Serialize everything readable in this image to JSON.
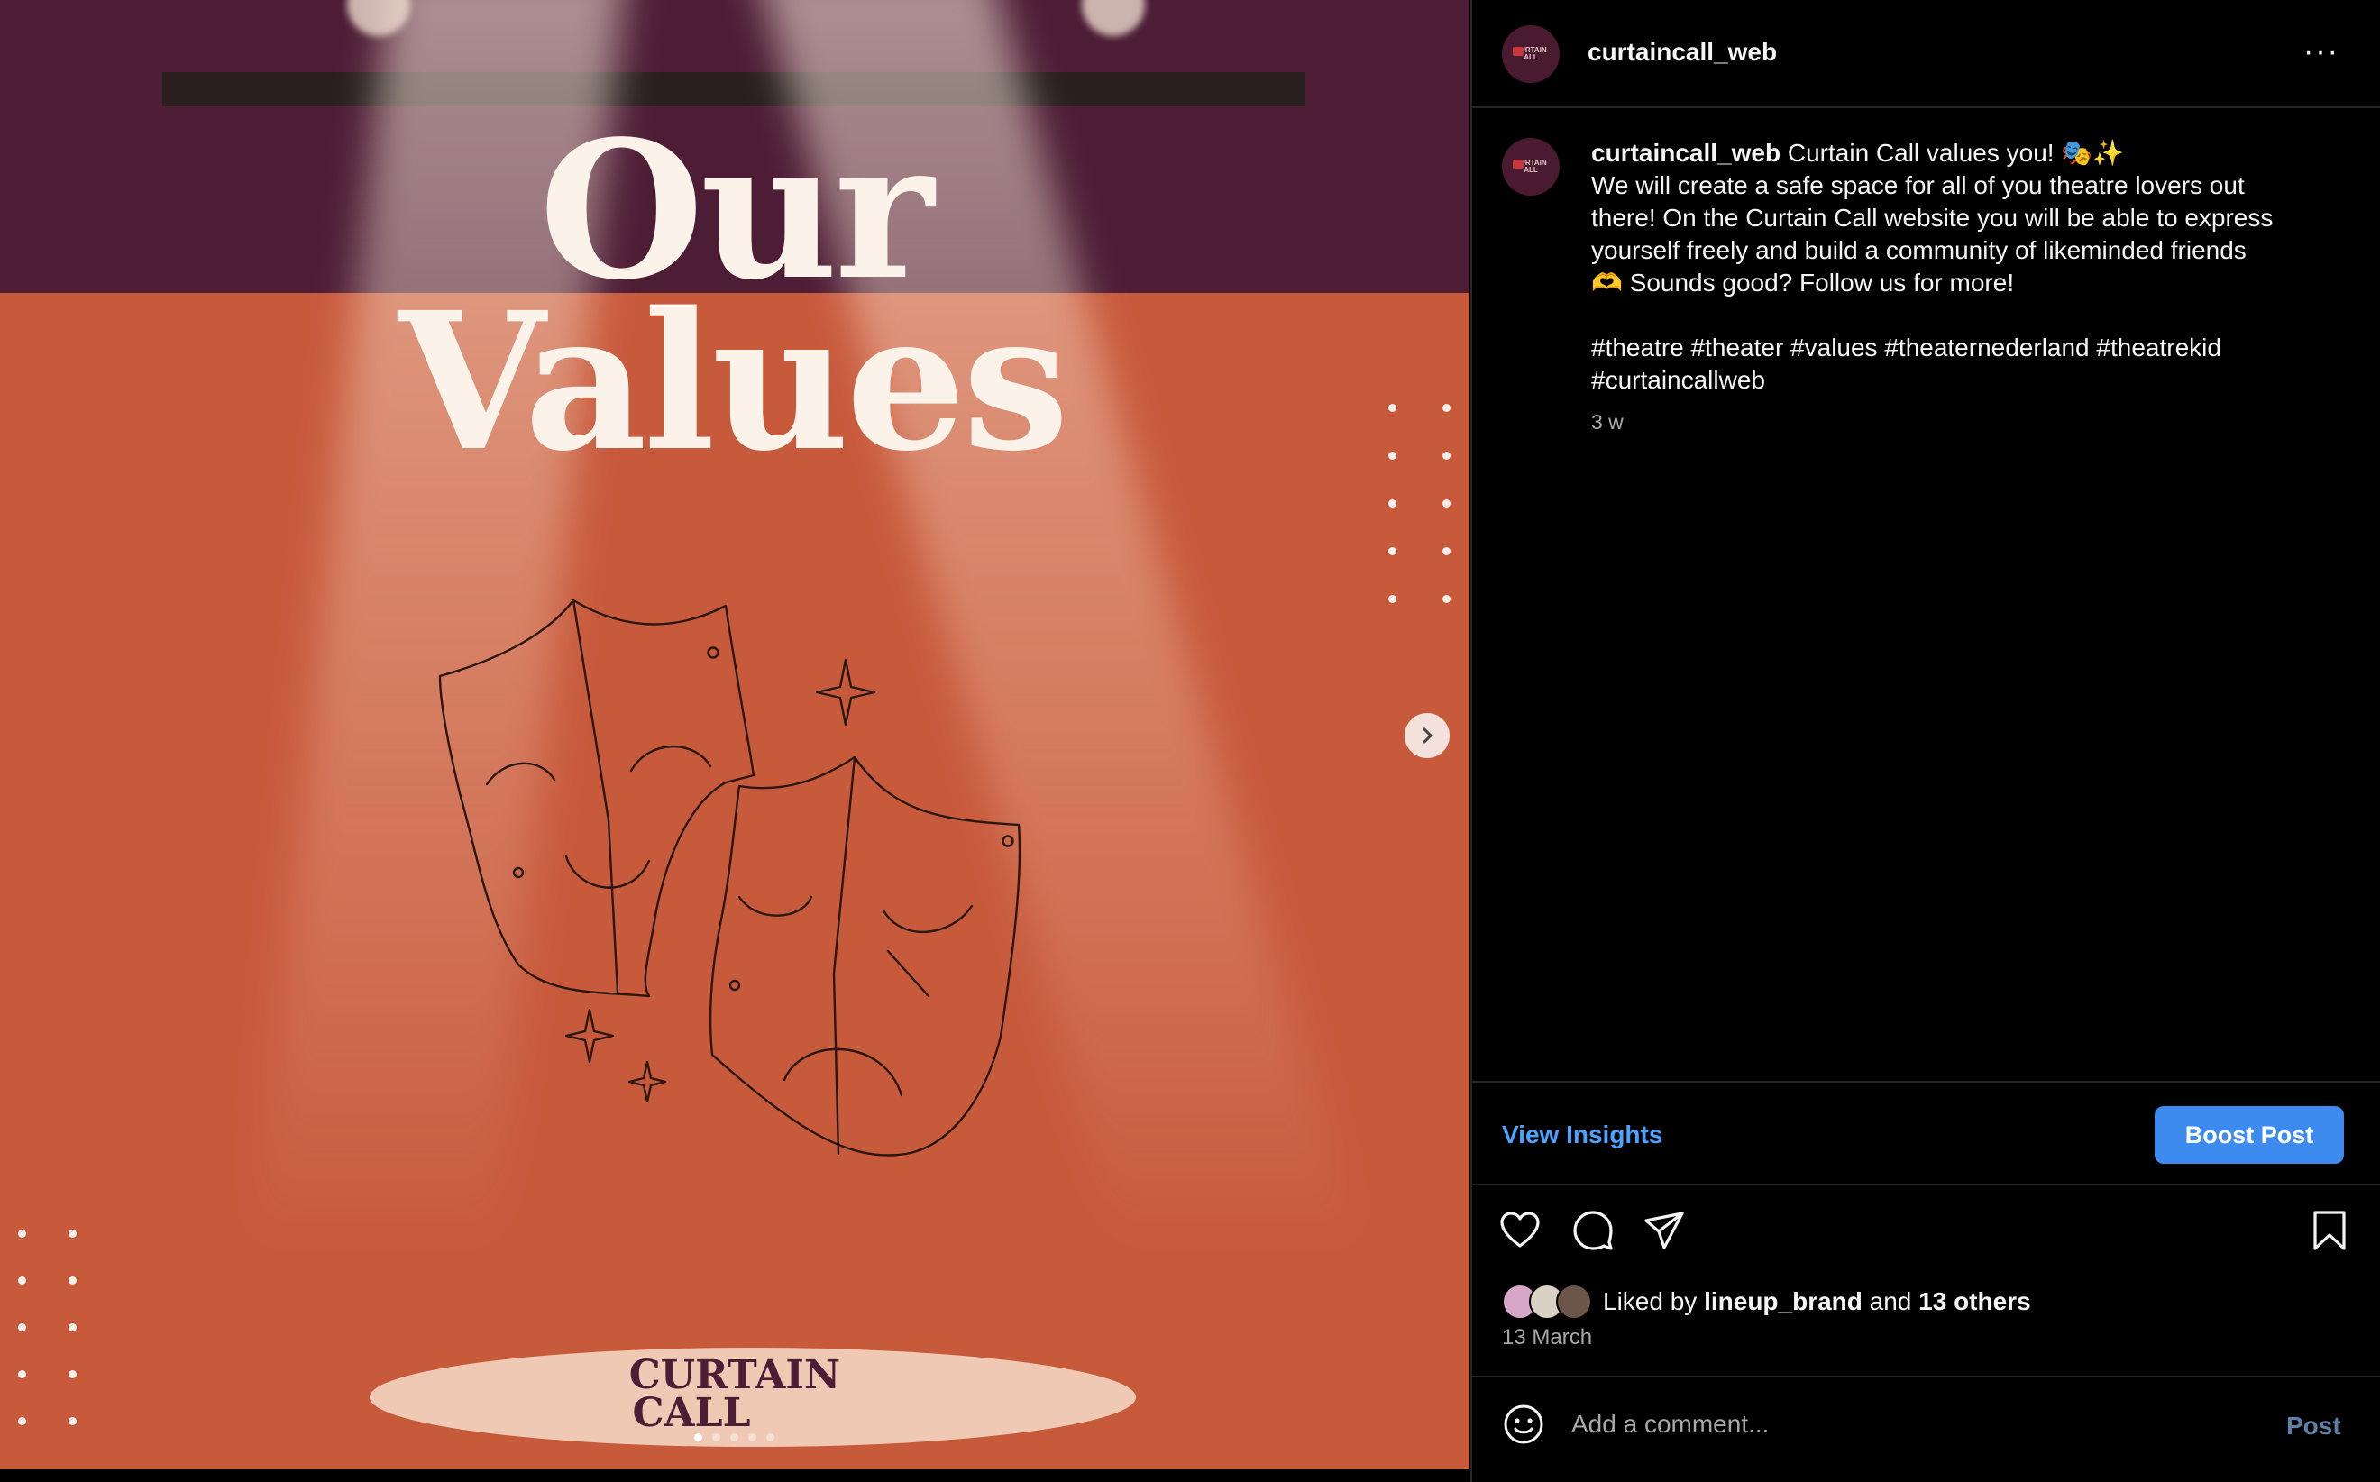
{
  "post_image": {
    "headline_line1": "Our",
    "headline_line2": "Values",
    "brand_line1": "CURTAIN",
    "brand_line2": "CALL",
    "carousel_count": 5,
    "carousel_active": 0,
    "next_icon": "chevron-right-icon"
  },
  "header": {
    "username": "curtaincall_web",
    "more_icon": "more-horizontal-icon",
    "more_label": "···",
    "avatar_text1": "CURTAIN",
    "avatar_text2": "ALL"
  },
  "caption": {
    "username": "curtaincall_web",
    "line1": " Curtain Call values you! 🎭✨",
    "line2": "We will create a safe space for all of you theatre lovers out",
    "line3": "there! On the Curtain Call website you will be able to express",
    "line4": "yourself freely and build a community of likeminded friends",
    "line5": "🫶 Sounds good? Follow us for more!",
    "hashtags1": "#theatre #theater #values #theaternederland #theatrekid",
    "hashtags2": "#curtaincallweb",
    "age": "3 w"
  },
  "insights": {
    "view_label": "View Insights",
    "boost_label": "Boost Post"
  },
  "actions": {
    "icons": [
      "heart-icon",
      "comment-icon",
      "share-icon",
      "bookmark-icon"
    ]
  },
  "likes": {
    "prefix": "Liked by ",
    "user": "lineup_brand",
    "middle": " and ",
    "others": "13 others",
    "date": "13 March"
  },
  "comment": {
    "placeholder": "Add a comment...",
    "post_label": "Post",
    "emoji_icon": "emoji-icon"
  },
  "colors": {
    "image_background": "#c85a3c",
    "image_top_band": "#4d1d35",
    "accent_blue": "#3e8bf0",
    "link_blue": "#4aa3ff"
  }
}
